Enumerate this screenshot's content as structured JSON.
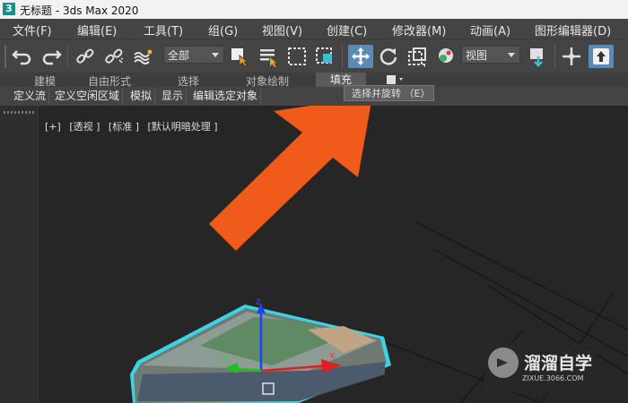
{
  "window": {
    "logo": "3",
    "title": "无标题 - 3ds Max 2020"
  },
  "menu": {
    "items": [
      "文件(F)",
      "编辑(E)",
      "工具(T)",
      "组(G)",
      "视图(V)",
      "创建(C)",
      "修改器(M)",
      "动画(A)",
      "图形编辑器(D)"
    ]
  },
  "toolbar": {
    "selection_filter": "全部",
    "ref_coord": "视图",
    "icons": [
      "undo-icon",
      "redo-icon",
      "link-icon",
      "unlink-icon",
      "bind-space-warp-icon",
      "select-object-icon",
      "select-by-name-icon",
      "rect-selection-icon",
      "window-crossing-icon",
      "select-move-icon",
      "select-rotate-icon",
      "select-scale-icon",
      "select-place-icon",
      "use-pivot-icon",
      "select-manipulate-icon",
      "keyboard-shortcut-icon"
    ]
  },
  "ribbon": {
    "tabs": [
      "建模",
      "自由形式",
      "选择",
      "对象绘制",
      "填充"
    ],
    "active_tab": "填充"
  },
  "subbar": {
    "buttons": [
      "定义流",
      "定义空闲区域",
      "模拟",
      "显示",
      "编辑选定对象"
    ]
  },
  "tooltip": {
    "text": "选择并旋转 （E）"
  },
  "viewport": {
    "labels": [
      "[+]",
      "[透视 ]",
      "[标准 ]",
      "[默认明暗处理 ]"
    ],
    "gizmo_axes": [
      "x",
      "y",
      "z"
    ]
  },
  "watermark": {
    "title": "溜溜自学",
    "url": "ZIXUE.3066.COM"
  },
  "colors": {
    "accent": "#5b8ab4",
    "arrow": "#f05a1a",
    "selection_outline": "#3cd2e6"
  }
}
